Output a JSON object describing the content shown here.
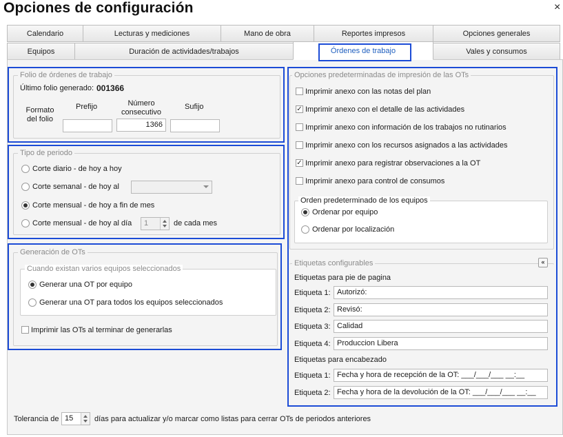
{
  "window": {
    "title": "Opciones de configuración",
    "close": "×"
  },
  "tabs_row1": [
    {
      "label": "Calendario"
    },
    {
      "label": "Lecturas y mediciones"
    },
    {
      "label": "Mano de obra"
    },
    {
      "label": "Reportes impresos"
    },
    {
      "label": "Opciones generales"
    }
  ],
  "tabs_row2": [
    {
      "label": "Equipos"
    },
    {
      "label": "Duración de actividades/trabajos"
    },
    {
      "label": "Órdenes de trabajo"
    },
    {
      "label": "Vales y consumos"
    }
  ],
  "folio": {
    "group_label": "Folio de órdenes de trabajo",
    "last_label": "Último folio generado:",
    "last_value": "001366",
    "format_label": "Formato del folio",
    "prefix_label": "Prefijo",
    "number_label": "Número consecutivo",
    "suffix_label": "Sufijo",
    "prefix_value": "",
    "number_value": "1366",
    "suffix_value": ""
  },
  "periodo": {
    "group_label": "Tipo de periodo",
    "options": [
      {
        "label": "Corte diario - de hoy a hoy"
      },
      {
        "label": "Corte semanal - de hoy al"
      },
      {
        "label": "Corte mensual - de hoy a fin de mes"
      },
      {
        "label": "Corte mensual - de hoy al día"
      }
    ],
    "day_value": "1",
    "day_suffix": "de cada mes"
  },
  "generacion": {
    "group_label": "Generación de OTs",
    "sub_label": "Cuando existan varios equipos seleccionados",
    "options": [
      {
        "label": "Generar una OT por equipo"
      },
      {
        "label": "Generar una OT para todos los equipos seleccionados"
      }
    ],
    "print_label": "Imprimir las OTs al terminar de generarlas"
  },
  "impresion": {
    "group_label": "Opciones predeterminadas de impresión de las OTs",
    "items": [
      {
        "label": "Imprimir anexo con las notas del plan",
        "check": ""
      },
      {
        "label": "Imprimir anexo con el detalle de las actividades",
        "check": "✓"
      },
      {
        "label": "Imprimir anexo con información de los trabajos no rutinarios",
        "check": ""
      },
      {
        "label": "Imprimir anexo con los recursos asignados a las actividades",
        "check": ""
      },
      {
        "label": "Imprimir anexo para registrar observaciones a la OT",
        "check": "✓"
      },
      {
        "label": "Imprimir anexo para control de consumos",
        "check": ""
      }
    ],
    "orden_label": "Orden predeterminado de los equipos",
    "orden_options": [
      {
        "label": "Ordenar por equipo"
      },
      {
        "label": "Ordenar por localización"
      }
    ]
  },
  "etiquetas": {
    "group_label": "Etiquetas configurables",
    "collapse": "«",
    "pie_label": "Etiquetas para pie de pagina",
    "pie": [
      {
        "label": "Etiqueta 1:",
        "value": "Autorizó:"
      },
      {
        "label": "Etiqueta 2:",
        "value": "Revisó:"
      },
      {
        "label": "Etiqueta 3:",
        "value": "Calidad"
      },
      {
        "label": "Etiqueta 4:",
        "value": "Produccion Libera"
      }
    ],
    "enc_label": "Etiquetas para encabezado",
    "enc": [
      {
        "label": "Etiqueta 1:",
        "value": "Fecha y hora de recepción de la OT: ___/___/___ __:__"
      },
      {
        "label": "Etiqueta 2:",
        "value": "Fecha y hora de la devolución de la OT: ___/___/___ __:__"
      }
    ]
  },
  "tolerancia": {
    "label": "Tolerancia de",
    "value": "15",
    "suffix": "días para actualizar y/o marcar como listas para cerrar OTs de periodos anteriores"
  }
}
